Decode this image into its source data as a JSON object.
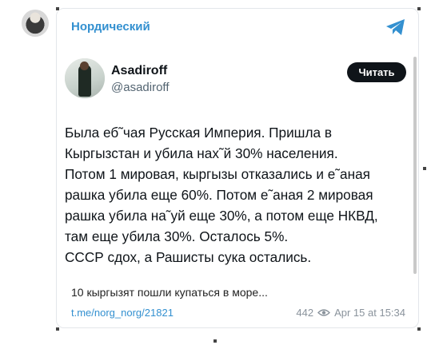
{
  "post": {
    "channel_name": "Нордический",
    "tweet": {
      "display_name": "Asadiroff",
      "handle": "@asadiroff",
      "read_button": "Читать",
      "text": "Была еб˜чая Русская Империя. Пришла в\nКыргызстан и убила нах˜й 30% населения.\nПотом 1 мировая, кыргызы отказались и е˜аная\nрашка убила еще 60%. Потом е˜аная 2 мировая\nрашка убила на˜уй еще 30%, а потом еще НКВД,\nтам еще убила 30%. Осталось 5%.\nСССР сдох, а Рашисты сука остались."
    },
    "preview_text": "10 кыргызят пошли купаться в море...",
    "link": "t.me/norg_norg/21821",
    "views": "442",
    "timestamp": "Apr 15 at 15:34"
  },
  "colors": {
    "accent": "#3390d0",
    "tweet_text": "#0f1419",
    "muted": "#8a939c"
  },
  "icons": [
    "telegram-icon",
    "eye-icon"
  ]
}
